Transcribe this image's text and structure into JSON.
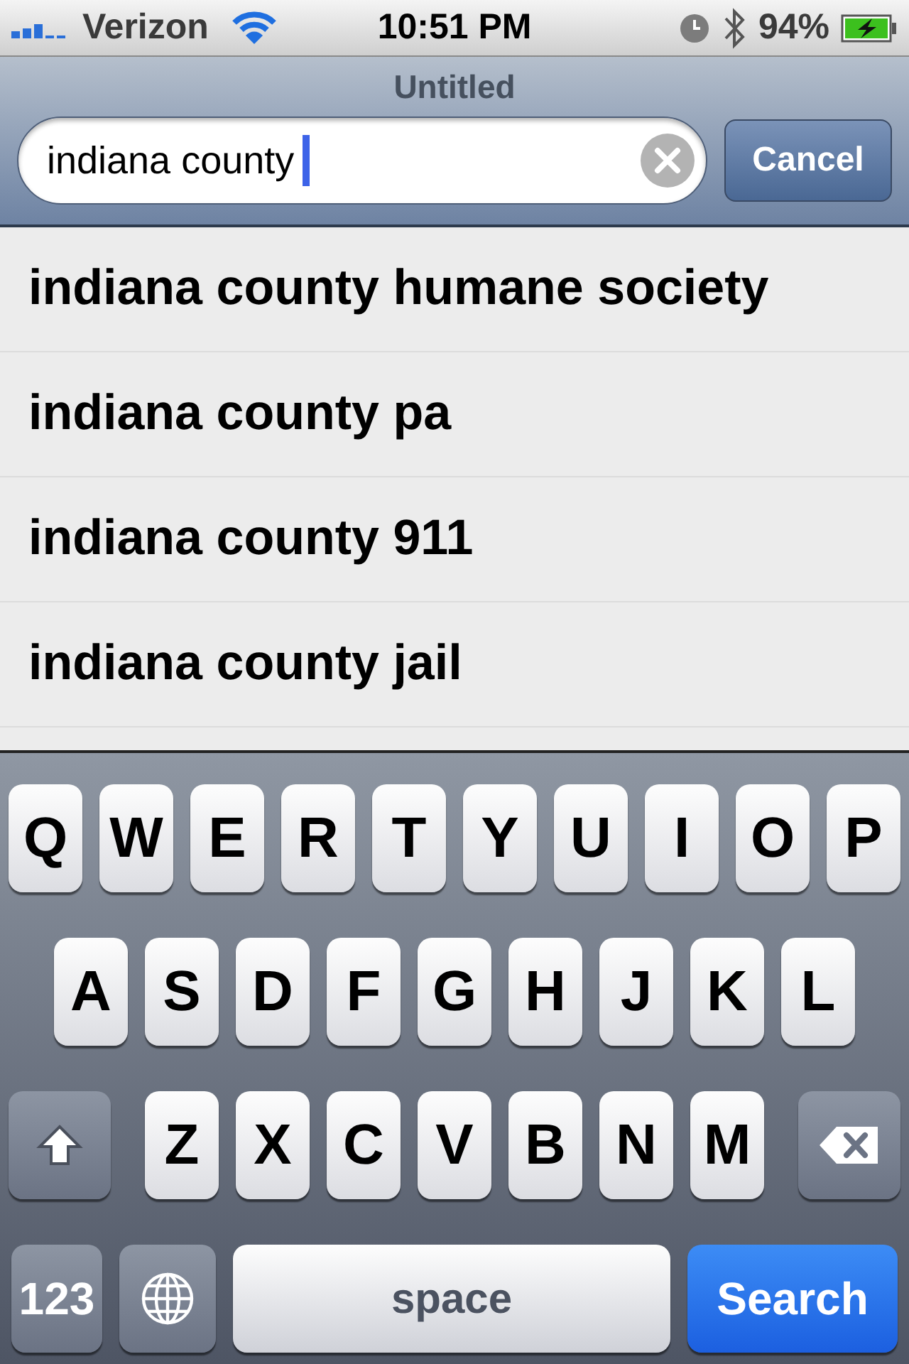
{
  "status_bar": {
    "carrier": "Verizon",
    "time": "10:51 PM",
    "battery": "94%"
  },
  "nav": {
    "title": "Untitled"
  },
  "search": {
    "value": "indiana county",
    "cancel": "Cancel"
  },
  "suggestions": [
    {
      "text": "indiana county humane society"
    },
    {
      "text": "indiana county pa"
    },
    {
      "text": "indiana county 911"
    },
    {
      "text": "indiana county jail"
    }
  ],
  "keyboard": {
    "rows": [
      [
        {
          "kind": "letter",
          "label": "Q"
        },
        {
          "kind": "letter",
          "label": "W"
        },
        {
          "kind": "letter",
          "label": "E"
        },
        {
          "kind": "letter",
          "label": "R"
        },
        {
          "kind": "letter",
          "label": "T"
        },
        {
          "kind": "letter",
          "label": "Y"
        },
        {
          "kind": "letter",
          "label": "U"
        },
        {
          "kind": "letter",
          "label": "I"
        },
        {
          "kind": "letter",
          "label": "O"
        },
        {
          "kind": "letter",
          "label": "P"
        }
      ],
      [
        {
          "kind": "letter",
          "label": "A"
        },
        {
          "kind": "letter",
          "label": "S"
        },
        {
          "kind": "letter",
          "label": "D"
        },
        {
          "kind": "letter",
          "label": "F"
        },
        {
          "kind": "letter",
          "label": "G"
        },
        {
          "kind": "letter",
          "label": "H"
        },
        {
          "kind": "letter",
          "label": "J"
        },
        {
          "kind": "letter",
          "label": "K"
        },
        {
          "kind": "letter",
          "label": "L"
        }
      ],
      [
        {
          "kind": "shift"
        },
        {
          "kind": "letter",
          "label": "Z"
        },
        {
          "kind": "letter",
          "label": "X"
        },
        {
          "kind": "letter",
          "label": "C"
        },
        {
          "kind": "letter",
          "label": "V"
        },
        {
          "kind": "letter",
          "label": "B"
        },
        {
          "kind": "letter",
          "label": "N"
        },
        {
          "kind": "letter",
          "label": "M"
        },
        {
          "kind": "backspace"
        }
      ]
    ],
    "bottom_row": {
      "numbers_key": "123",
      "space_key": "space",
      "search_key": "Search"
    }
  }
}
